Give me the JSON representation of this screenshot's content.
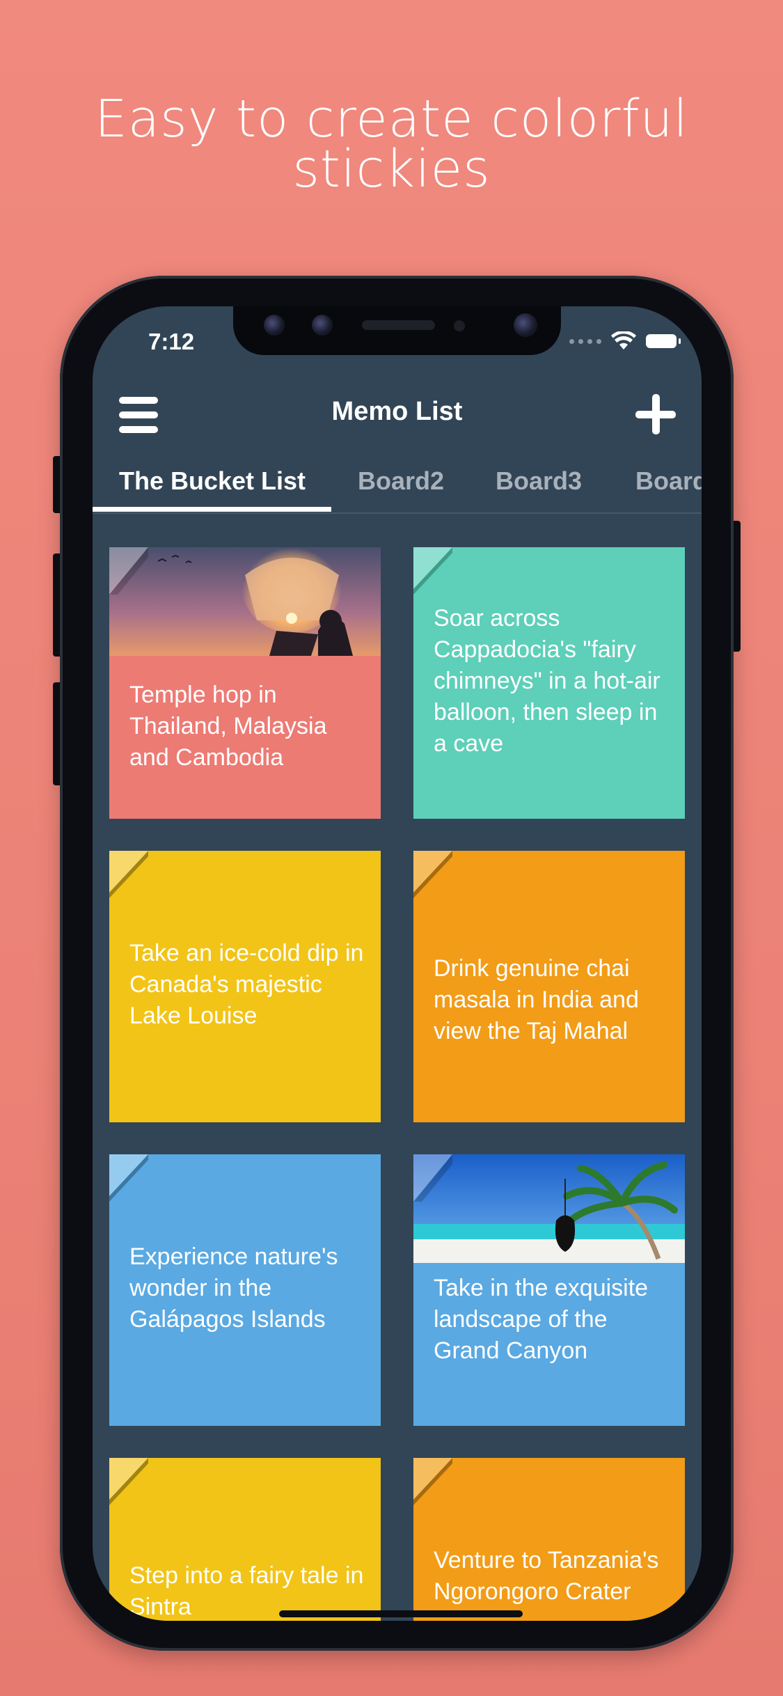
{
  "headline": {
    "line1": "Easy to create colorful",
    "line2": "stickies"
  },
  "status_bar": {
    "time": "7:12"
  },
  "app_bar": {
    "title": "Memo List",
    "menu_icon": "hamburger-icon",
    "add_icon": "plus-icon"
  },
  "tabs": [
    "The Bucket List",
    "Board2",
    "Board3",
    "Board"
  ],
  "notes": [
    {
      "text": "Temple hop in Thailand, Malaysia and Cambodia",
      "color": "#ec7b74",
      "image": "lantern-photo"
    },
    {
      "text": "Soar across Cappadocia's \"fairy chimneys\" in a hot-air balloon, then sleep in a cave",
      "color": "#5ecfb9",
      "image": ""
    },
    {
      "text": "Take an ice-cold dip in Canada's majestic Lake Louise",
      "color": "#f2c417",
      "image": ""
    },
    {
      "text": "Drink genuine chai masala in India and view the Taj Mahal",
      "color": "#f29c17",
      "image": ""
    },
    {
      "text": "Experience nature's wonder in the Galápagos Islands",
      "color": "#5aa9e2",
      "image": ""
    },
    {
      "text": "Take in the exquisite landscape of the Grand Canyon",
      "color": "#5aa9e2",
      "image": "beach-photo"
    },
    {
      "text": "Step into a fairy tale in Sintra",
      "color": "#f2c417",
      "image": ""
    },
    {
      "text": "Venture to Tanzania's Ngorongoro Crater",
      "color": "#f29c17",
      "image": ""
    }
  ]
}
